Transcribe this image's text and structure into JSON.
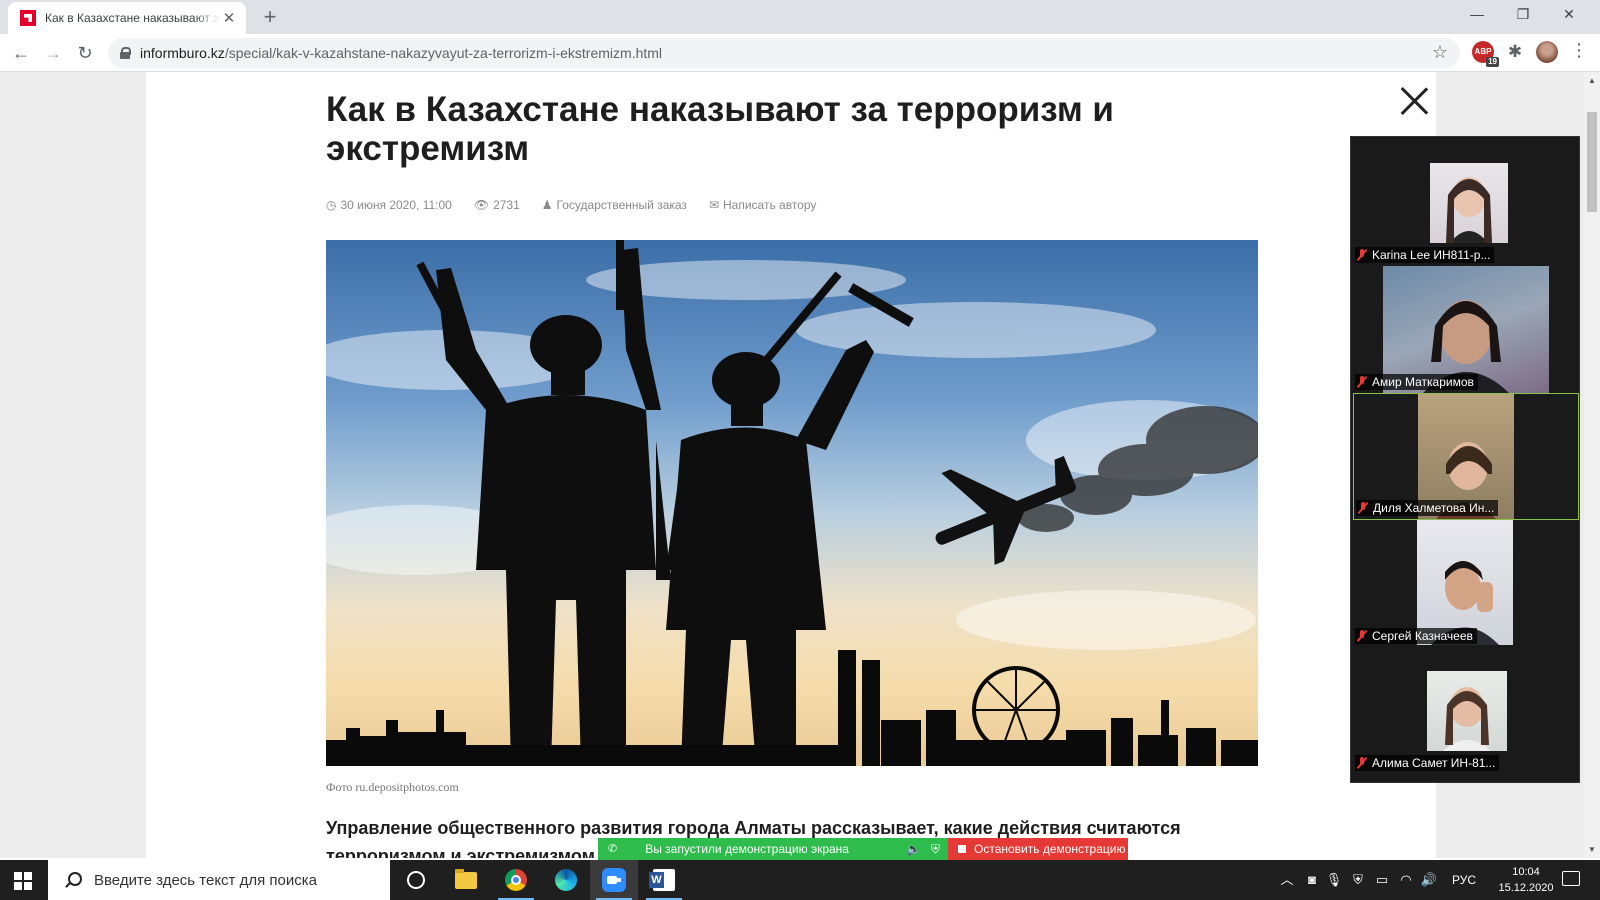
{
  "browser": {
    "tab_title": "Как в Казахстане наказывают за терроризм и экстремизм",
    "tab_close": "✕",
    "new_tab": "+",
    "url_host": "informburo.kz",
    "url_path": "/special/kak-v-kazahstane-nakazyvayut-za-terrorizm-i-ekstremizm.html",
    "abp_label": "ABP",
    "abp_count": "19",
    "window_controls": {
      "minimize": "—",
      "restore": "❐",
      "close": "✕"
    }
  },
  "article": {
    "headline": "Как в Казахстане наказывают за терроризм и экстремизм",
    "date": "30 июня 2020, 11:00",
    "views": "2731",
    "category": "Государственный заказ",
    "contact": "Написать автору",
    "photo_caption": "Фото ru.depositphotos.com",
    "lead": "Управление общественного развития города Алматы рассказывает, какие действия считаются терроризмом и экстремизмом и"
  },
  "zoom": {
    "participants": [
      {
        "name": "Karina Lee ИН811-р...",
        "active": false
      },
      {
        "name": "Амир Маткаримов",
        "active": false
      },
      {
        "name": "Диля Халметова Ин...",
        "active": true
      },
      {
        "name": "Сергей Казначеев",
        "active": false
      },
      {
        "name": "Алима Самет ИН-81...",
        "active": false
      }
    ]
  },
  "share_banner": {
    "status": "Вы запустили демонстрацию экрана",
    "stop": "Остановить демонстрацию"
  },
  "taskbar": {
    "search_placeholder": "Введите здесь текст для поиска",
    "language": "РУС",
    "time": "10:04",
    "date": "15.12.2020"
  },
  "colors": {
    "share_green": "#2ebd4d",
    "share_red": "#e53935",
    "active_speaker": "#8bc34a",
    "taskbar": "#1f1f1f"
  }
}
